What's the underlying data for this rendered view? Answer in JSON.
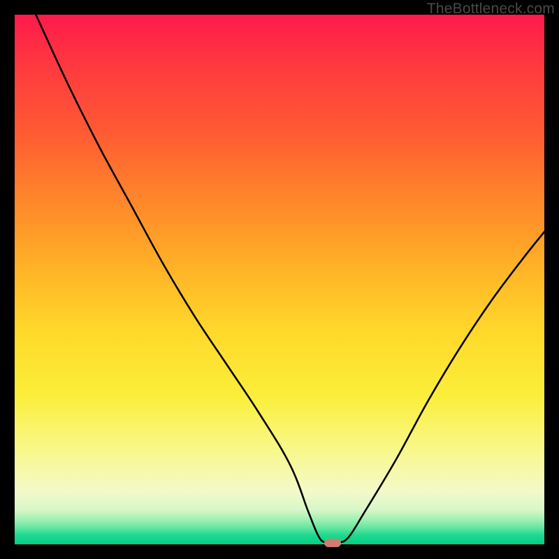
{
  "watermark": "TheBottleneck.com",
  "chart_data": {
    "type": "line",
    "title": "",
    "xlabel": "",
    "ylabel": "",
    "xlim": [
      0,
      100
    ],
    "ylim": [
      0,
      100
    ],
    "grid": false,
    "series": [
      {
        "name": "bottleneck-curve",
        "x": [
          4,
          10,
          16,
          22,
          28,
          34,
          40,
          46,
          52,
          55.5,
          57.5,
          59,
          61,
          63,
          66,
          72,
          78,
          84,
          90,
          96,
          100
        ],
        "y": [
          100,
          87,
          75,
          64,
          53,
          43,
          34,
          25,
          15,
          6,
          1.3,
          0.3,
          0.3,
          1.3,
          6,
          16,
          27,
          37,
          46,
          54,
          59
        ]
      }
    ],
    "marker": {
      "name": "optimal-point",
      "x": 60,
      "y": 0.3,
      "width_pct": 3.2,
      "height_pct": 1.6,
      "color": "#d37a72"
    },
    "background": {
      "type": "vertical-gradient",
      "stops": [
        {
          "pct": 0,
          "color": "#ff1a4b"
        },
        {
          "pct": 50,
          "color": "#ffc728"
        },
        {
          "pct": 85,
          "color": "#f6f7b0"
        },
        {
          "pct": 100,
          "color": "#00cf85"
        }
      ]
    }
  }
}
